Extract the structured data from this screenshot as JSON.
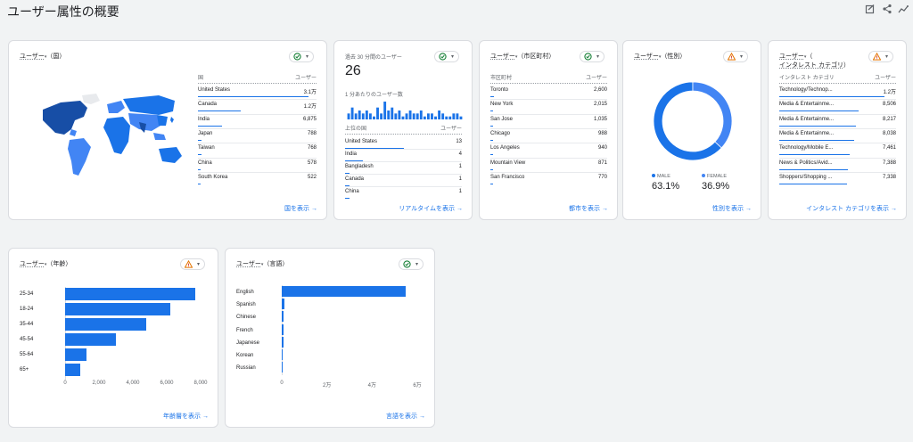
{
  "page_title": "ユーザー属性の概要",
  "header_icons": [
    "customize-report-icon",
    "share-icon",
    "insights-icon"
  ],
  "country_card": {
    "title_prefix": "ユーザー",
    "title_dim": "（国）",
    "status": "ok",
    "col_dim": "国",
    "col_metric": "ユーザー",
    "rows": [
      {
        "label": "United States",
        "value": "3.1万",
        "frac": 0.93
      },
      {
        "label": "Canada",
        "value": "1.2万",
        "frac": 0.36
      },
      {
        "label": "India",
        "value": "6,875",
        "frac": 0.2
      },
      {
        "label": "Japan",
        "value": "788",
        "frac": 0.03
      },
      {
        "label": "Taiwan",
        "value": "768",
        "frac": 0.03
      },
      {
        "label": "China",
        "value": "578",
        "frac": 0.02
      },
      {
        "label": "South Korea",
        "value": "522",
        "frac": 0.02
      }
    ],
    "link": "国を表示"
  },
  "realtime_card": {
    "label": "過去 30 分間のユーザー",
    "value": "26",
    "sublabel": "1 分あたりのユーザー数",
    "status": "ok",
    "per_minute": [
      2,
      4,
      2,
      3,
      2,
      3,
      2,
      1,
      4,
      2,
      6,
      3,
      4,
      2,
      3,
      1,
      2,
      3,
      2,
      2,
      3,
      1,
      2,
      2,
      1,
      3,
      2,
      1,
      1,
      2,
      2,
      1
    ],
    "col_dim": "上位の国",
    "col_metric": "ユーザー",
    "rows": [
      {
        "label": "United States",
        "value": "13",
        "frac": 0.5
      },
      {
        "label": "India",
        "value": "4",
        "frac": 0.15
      },
      {
        "label": "Bangladesh",
        "value": "1",
        "frac": 0.04
      },
      {
        "label": "Canada",
        "value": "1",
        "frac": 0.04
      },
      {
        "label": "China",
        "value": "1",
        "frac": 0.04
      }
    ],
    "link": "リアルタイムを表示"
  },
  "city_card": {
    "title_prefix": "ユーザー",
    "title_dim": "（市区町村）",
    "status": "ok",
    "col_dim": "市区町村",
    "col_metric": "ユーザー",
    "rows": [
      {
        "label": "Toronto",
        "value": "2,600",
        "frac": 0.03
      },
      {
        "label": "New York",
        "value": "2,015",
        "frac": 0.025
      },
      {
        "label": "San Jose",
        "value": "1,035",
        "frac": 0.02
      },
      {
        "label": "Chicago",
        "value": "988",
        "frac": 0.02
      },
      {
        "label": "Los Angeles",
        "value": "940",
        "frac": 0.02
      },
      {
        "label": "Mountain View",
        "value": "871",
        "frac": 0.02
      },
      {
        "label": "San Francisco",
        "value": "770",
        "frac": 0.02
      }
    ],
    "link": "都市を表示"
  },
  "gender_card": {
    "title_prefix": "ユーザー",
    "title_dim": "（性別）",
    "status": "warning",
    "legend": [
      {
        "label": "MALE",
        "value": "63.1%",
        "color": "#1a73e8"
      },
      {
        "label": "FEMALE",
        "value": "36.9%",
        "color": "#4285f4"
      }
    ],
    "link": "性別を表示"
  },
  "interest_card": {
    "title_prefix": "ユーザー",
    "title_dim": "インタレスト カテゴリ",
    "status": "warning",
    "col_dim": "インタレスト カテゴリ",
    "col_metric": "ユーザー",
    "rows": [
      {
        "label": "Technology/Technop...",
        "value": "1.2万",
        "frac": 0.9
      },
      {
        "label": "Media & Entertainme...",
        "value": "8,506",
        "frac": 0.68
      },
      {
        "label": "Media & Entertainme...",
        "value": "8,217",
        "frac": 0.66
      },
      {
        "label": "Media & Entertainme...",
        "value": "8,038",
        "frac": 0.64
      },
      {
        "label": "Technology/Mobile E...",
        "value": "7,461",
        "frac": 0.6
      },
      {
        "label": "News & Politics/Avid...",
        "value": "7,388",
        "frac": 0.59
      },
      {
        "label": "Shoppers/Shopping ...",
        "value": "7,338",
        "frac": 0.58
      }
    ],
    "link": "インタレスト カテゴリを表示"
  },
  "age_card": {
    "title_prefix": "ユーザー",
    "title_dim": "（年齢）",
    "status": "warning",
    "link": "年齢層を表示"
  },
  "language_card": {
    "title_prefix": "ユーザー",
    "title_dim": "（言語）",
    "status": "ok",
    "link": "言語を表示"
  },
  "chart_data": [
    {
      "type": "pie",
      "id": "gender",
      "categories": [
        "MALE",
        "FEMALE"
      ],
      "values": [
        63.1,
        36.9
      ],
      "colors": [
        "#1a73e8",
        "#4285f4"
      ]
    },
    {
      "type": "bar",
      "id": "age",
      "orientation": "horizontal",
      "categories": [
        "25-34",
        "18-24",
        "35-44",
        "45-54",
        "55-64",
        "65+"
      ],
      "values": [
        7700,
        6200,
        4800,
        3000,
        1250,
        900
      ],
      "xlim": [
        0,
        8000
      ],
      "ticks": [
        "0",
        "2,000",
        "4,000",
        "6,000",
        "8,000"
      ],
      "color": "#1a73e8"
    },
    {
      "type": "bar",
      "id": "language",
      "orientation": "horizontal",
      "categories": [
        "English",
        "Spanish",
        "Chinese",
        "French",
        "Japanese",
        "Korean",
        "Russian"
      ],
      "values": [
        55000,
        1200,
        900,
        700,
        600,
        400,
        300
      ],
      "xlim": [
        0,
        60000
      ],
      "ticks": [
        "0",
        "2万",
        "4万",
        "6万"
      ],
      "color": "#1a73e8"
    }
  ]
}
